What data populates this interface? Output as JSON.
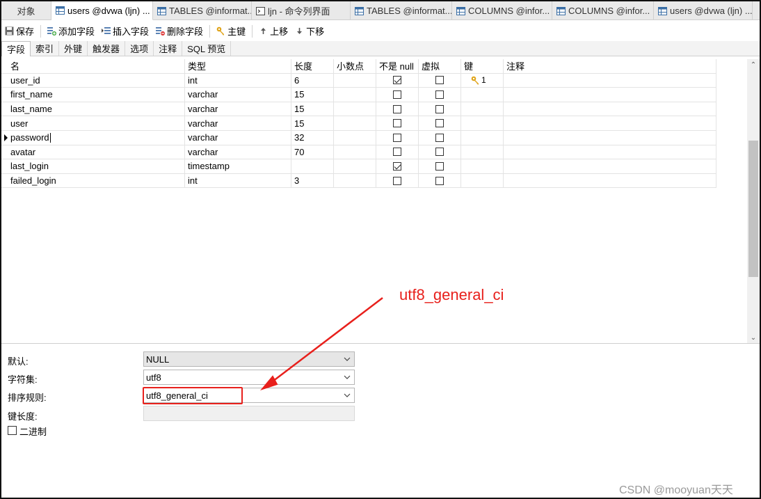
{
  "tabs": [
    {
      "label": "对象",
      "icon": "none"
    },
    {
      "label": "users @dvwa (ljn) ...",
      "icon": "table-icon",
      "active": true
    },
    {
      "label": "TABLES @informat...",
      "icon": "table-icon"
    },
    {
      "label": "ljn - 命令列界面",
      "icon": "console-icon"
    },
    {
      "label": "TABLES @informat...",
      "icon": "table-icon"
    },
    {
      "label": "COLUMNS @infor...",
      "icon": "table-icon"
    },
    {
      "label": "COLUMNS @infor...",
      "icon": "table-icon"
    },
    {
      "label": "users @dvwa (ljn) ...",
      "icon": "table-icon"
    }
  ],
  "toolbar": {
    "save": "保存",
    "add_field": "添加字段",
    "insert_field": "插入字段",
    "delete_field": "删除字段",
    "primary_key": "主键",
    "move_up": "上移",
    "move_down": "下移"
  },
  "subtabs": [
    "字段",
    "索引",
    "外键",
    "触发器",
    "选项",
    "注释",
    "SQL 预览"
  ],
  "grid": {
    "headers": {
      "name": "名",
      "type": "类型",
      "length": "长度",
      "decimals": "小数点",
      "not_null": "不是 null",
      "virtual": "虚拟",
      "key": "键",
      "comment": "注释"
    },
    "rows": [
      {
        "name": "user_id",
        "type": "int",
        "length": "6",
        "decimals": "",
        "not_null": true,
        "virtual": false,
        "key": "1",
        "comment": ""
      },
      {
        "name": "first_name",
        "type": "varchar",
        "length": "15",
        "decimals": "",
        "not_null": false,
        "virtual": false,
        "key": "",
        "comment": ""
      },
      {
        "name": "last_name",
        "type": "varchar",
        "length": "15",
        "decimals": "",
        "not_null": false,
        "virtual": false,
        "key": "",
        "comment": ""
      },
      {
        "name": "user",
        "type": "varchar",
        "length": "15",
        "decimals": "",
        "not_null": false,
        "virtual": false,
        "key": "",
        "comment": ""
      },
      {
        "name": "password",
        "type": "varchar",
        "length": "32",
        "decimals": "",
        "not_null": false,
        "virtual": false,
        "key": "",
        "comment": "",
        "current": true
      },
      {
        "name": "avatar",
        "type": "varchar",
        "length": "70",
        "decimals": "",
        "not_null": false,
        "virtual": false,
        "key": "",
        "comment": ""
      },
      {
        "name": "last_login",
        "type": "timestamp",
        "length": "",
        "decimals": "",
        "not_null": true,
        "virtual": false,
        "key": "",
        "comment": ""
      },
      {
        "name": "failed_login",
        "type": "int",
        "length": "3",
        "decimals": "",
        "not_null": false,
        "virtual": false,
        "key": "",
        "comment": ""
      }
    ]
  },
  "properties": {
    "default_label": "默认:",
    "default_value": "NULL",
    "charset_label": "字符集:",
    "charset_value": "utf8",
    "collation_label": "排序规则:",
    "collation_value": "utf8_general_ci",
    "key_length_label": "键长度:",
    "key_length_value": "",
    "binary_label": "二进制",
    "binary_checked": false
  },
  "annotation": {
    "text": "utf8_general_ci",
    "color": "#e8201c"
  },
  "watermark": "CSDN @mooyuan天天"
}
